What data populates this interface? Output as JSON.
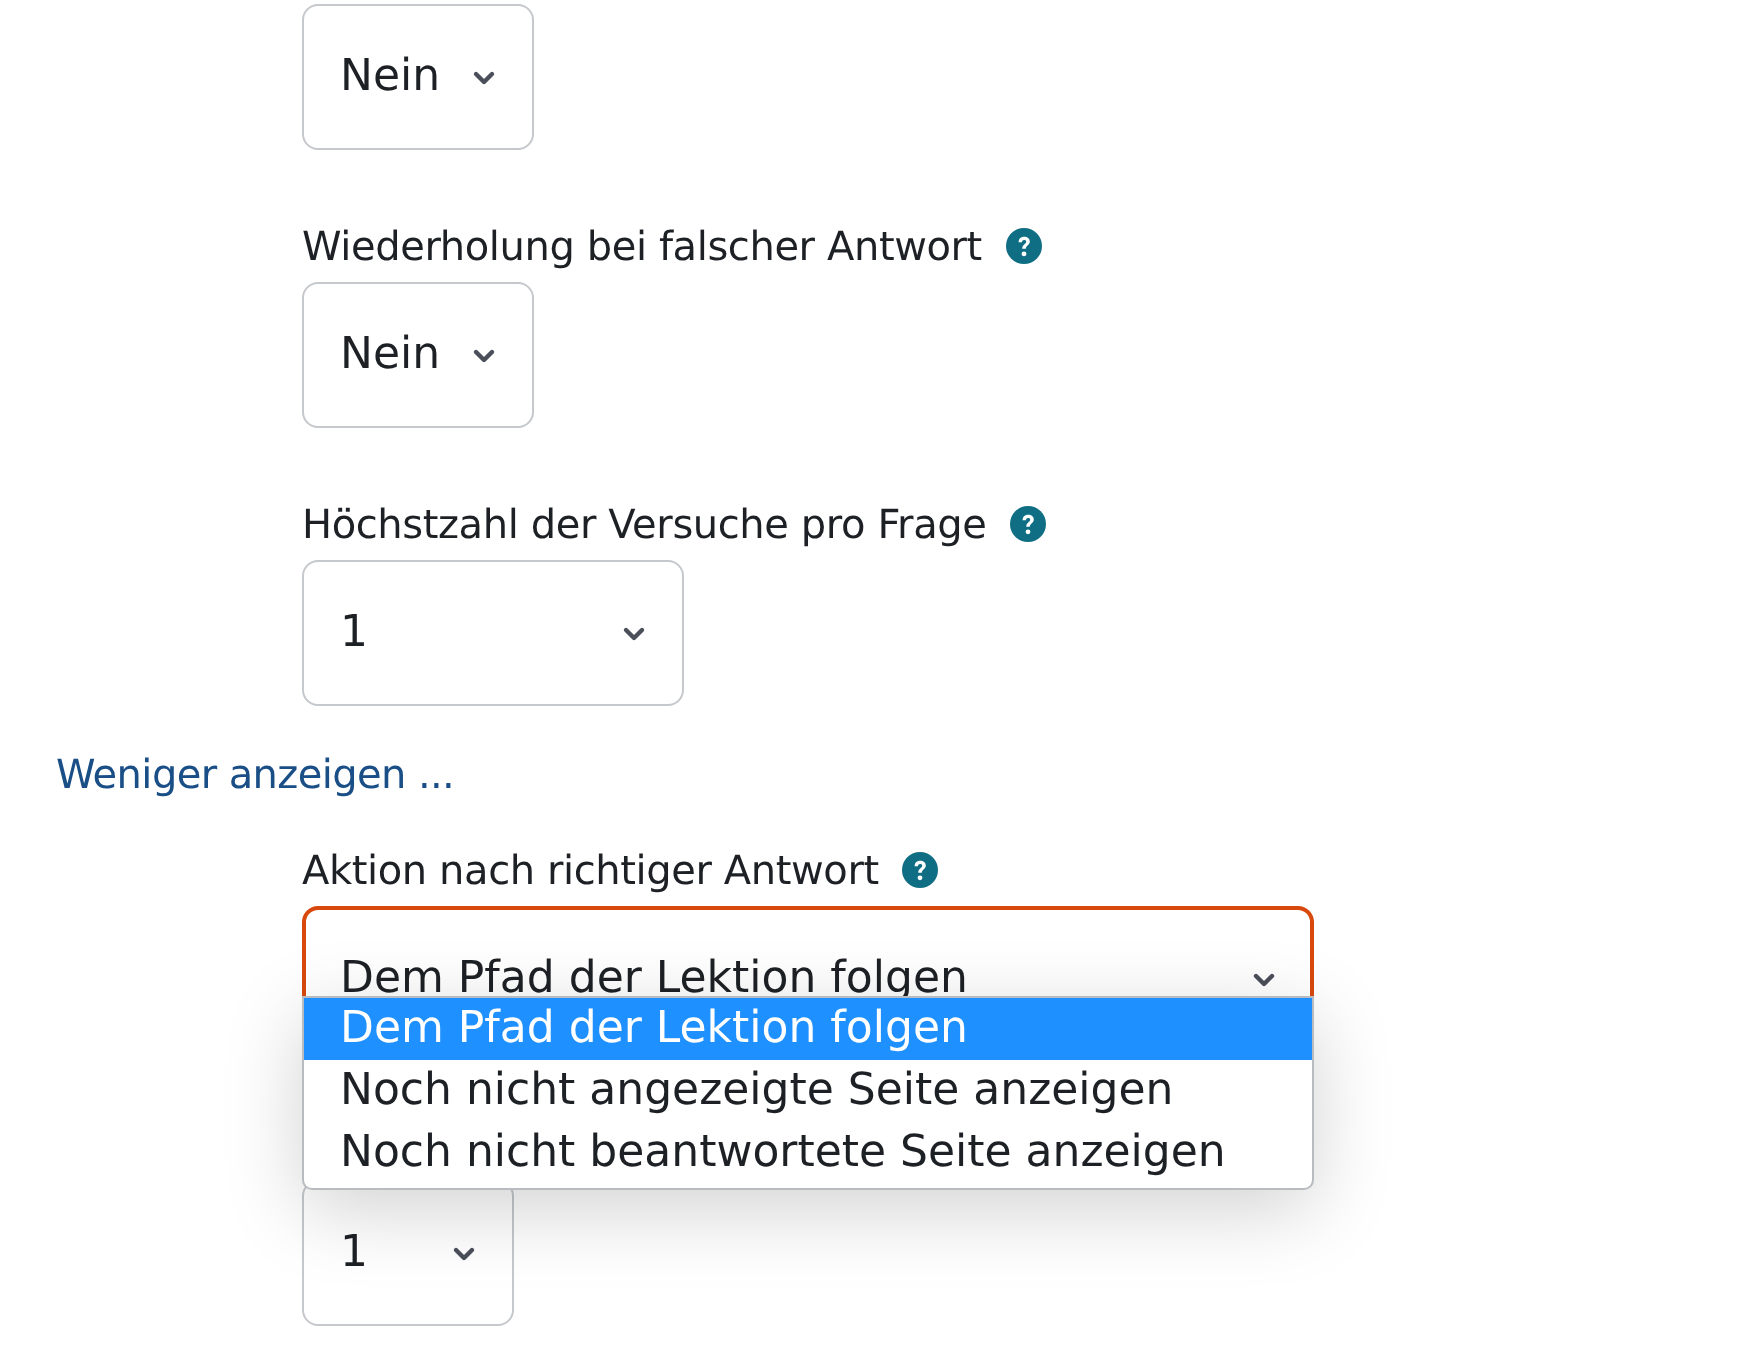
{
  "fields": [
    {
      "value": "Nein",
      "focused": false
    },
    {
      "label": "Wiederholung bei falscher Antwort",
      "help": true,
      "value": "Nein",
      "focused": false
    },
    {
      "label": "Höchstzahl der Versuche pro Frage",
      "help": true,
      "value": "1",
      "focused": false
    }
  ],
  "toggle_link": "Weniger anzeigen ...",
  "open_field": {
    "label": "Aktion nach richtiger Antwort",
    "help": true,
    "value": "Dem Pfad der Lektion folgen",
    "focused": true,
    "options": [
      {
        "label": "Dem Pfad der Lektion folgen",
        "selected": true
      },
      {
        "label": "Noch nicht angezeigte Seite anzeigen",
        "selected": false
      },
      {
        "label": "Noch nicht beantwortete Seite anzeigen",
        "selected": false
      }
    ]
  },
  "hidden_field": {
    "value": "1"
  }
}
